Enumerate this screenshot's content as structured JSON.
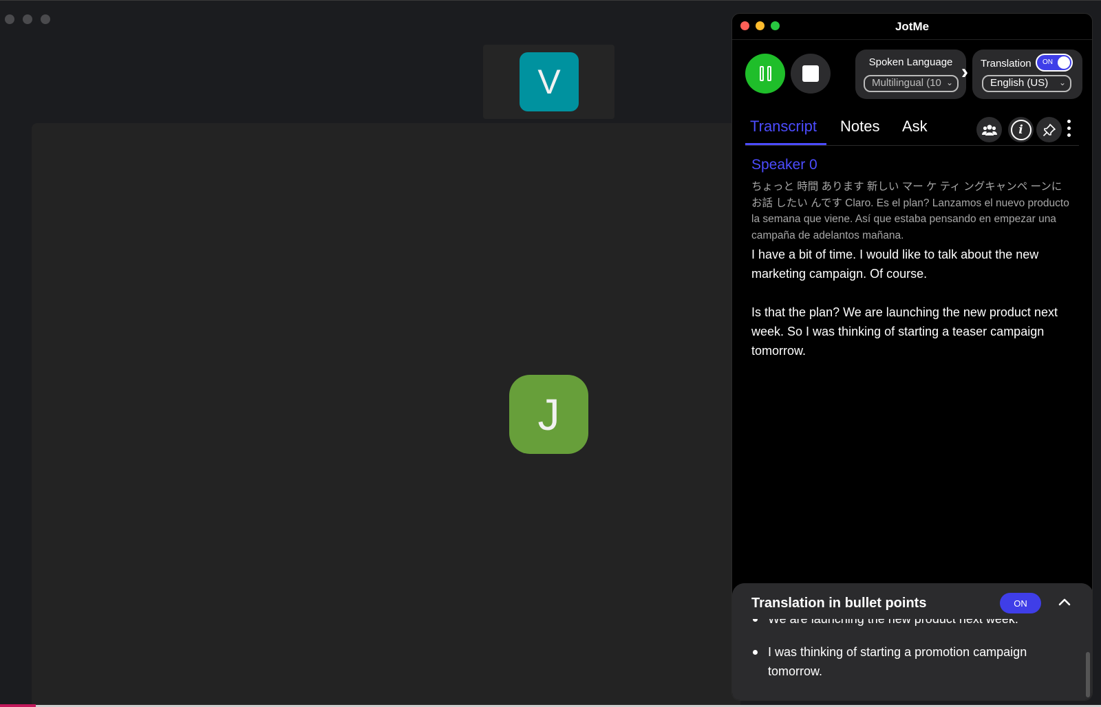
{
  "panel": {
    "title": "JotMe",
    "spoken_language_label": "Spoken Language",
    "spoken_language_value": "Multilingual (10",
    "translation_label": "Translation",
    "translation_toggle": "ON",
    "target_language_value": "English (US)"
  },
  "tabs": [
    {
      "label": "Transcript",
      "active": true
    },
    {
      "label": "Notes",
      "active": false
    },
    {
      "label": "Ask",
      "active": false
    }
  ],
  "transcript": {
    "speaker": "Speaker 0",
    "original": "ちょっと 時間 あります 新しい マー ケ ティ ングキャンペ ーンに お話 したい んです Claro. Es el plan? Lanzamos el nuevo producto la semana que viene. Así que estaba pensando en empezar una campaña de adelantos mañana.",
    "translated_1": "I have a bit of time. I would like to talk about the new marketing campaign. Of course.",
    "translated_2": "Is that the plan? We are launching the new product next week. So I was thinking of starting a teaser campaign tomorrow."
  },
  "bullets": {
    "title": "Translation in bullet points",
    "toggle": "ON",
    "items": [
      "We are launching the new product next week.",
      "I was thinking of starting a promotion campaign tomorrow."
    ]
  },
  "meeting": {
    "participant_top_initial": "V",
    "participant_main_initial": "J"
  },
  "colors": {
    "accent": "#4c4cff",
    "record_green": "#1fbe2a",
    "avatar_v": "#00929f",
    "avatar_j": "#679f3a"
  }
}
